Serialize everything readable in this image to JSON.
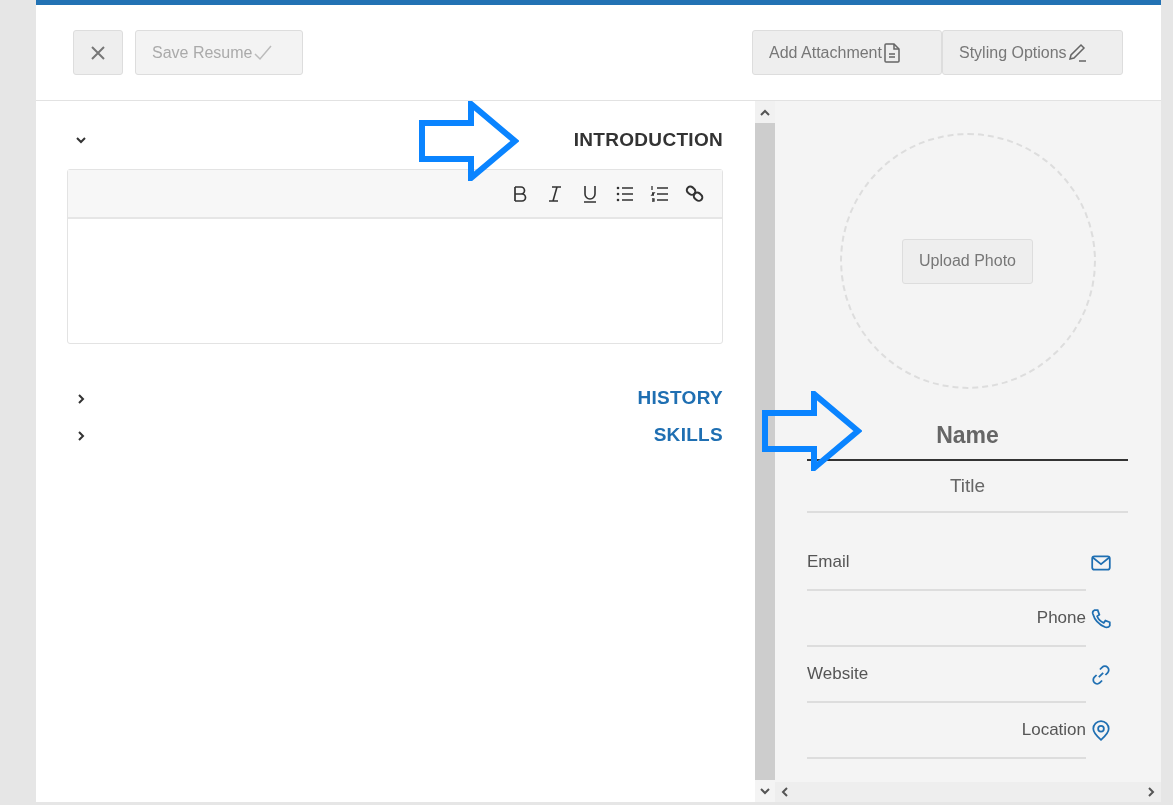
{
  "toolbar": {
    "close_button": {
      "kind": "close"
    },
    "buttons": [
      {
        "label": "Save Resume",
        "disabled": true
      },
      {
        "label": "Add Attachment",
        "disabled": false
      },
      {
        "label": "Styling Options",
        "disabled": false
      }
    ]
  },
  "sections": [
    {
      "title": "INTRODUCTION",
      "expanded": true,
      "callout": true
    },
    {
      "title": "HISTORY",
      "expanded": false,
      "callout": false
    },
    {
      "title": "SKILLS",
      "expanded": false,
      "callout": false
    }
  ],
  "editor_tools": [
    {
      "kind": "bold"
    },
    {
      "kind": "italic"
    },
    {
      "kind": "underline"
    },
    {
      "kind": "bullet-list"
    },
    {
      "kind": "numbered-list"
    },
    {
      "kind": "link"
    }
  ],
  "profile": {
    "upload_button": "Upload Photo",
    "name": {
      "placeholder": "Name",
      "callout": true
    },
    "title": {
      "placeholder": "Title"
    },
    "contacts": [
      {
        "kind": "email",
        "placeholder": "Email"
      },
      {
        "kind": "phone",
        "placeholder": "Phone"
      },
      {
        "kind": "website",
        "placeholder": "Website"
      },
      {
        "kind": "location",
        "placeholder": "Location"
      }
    ]
  }
}
